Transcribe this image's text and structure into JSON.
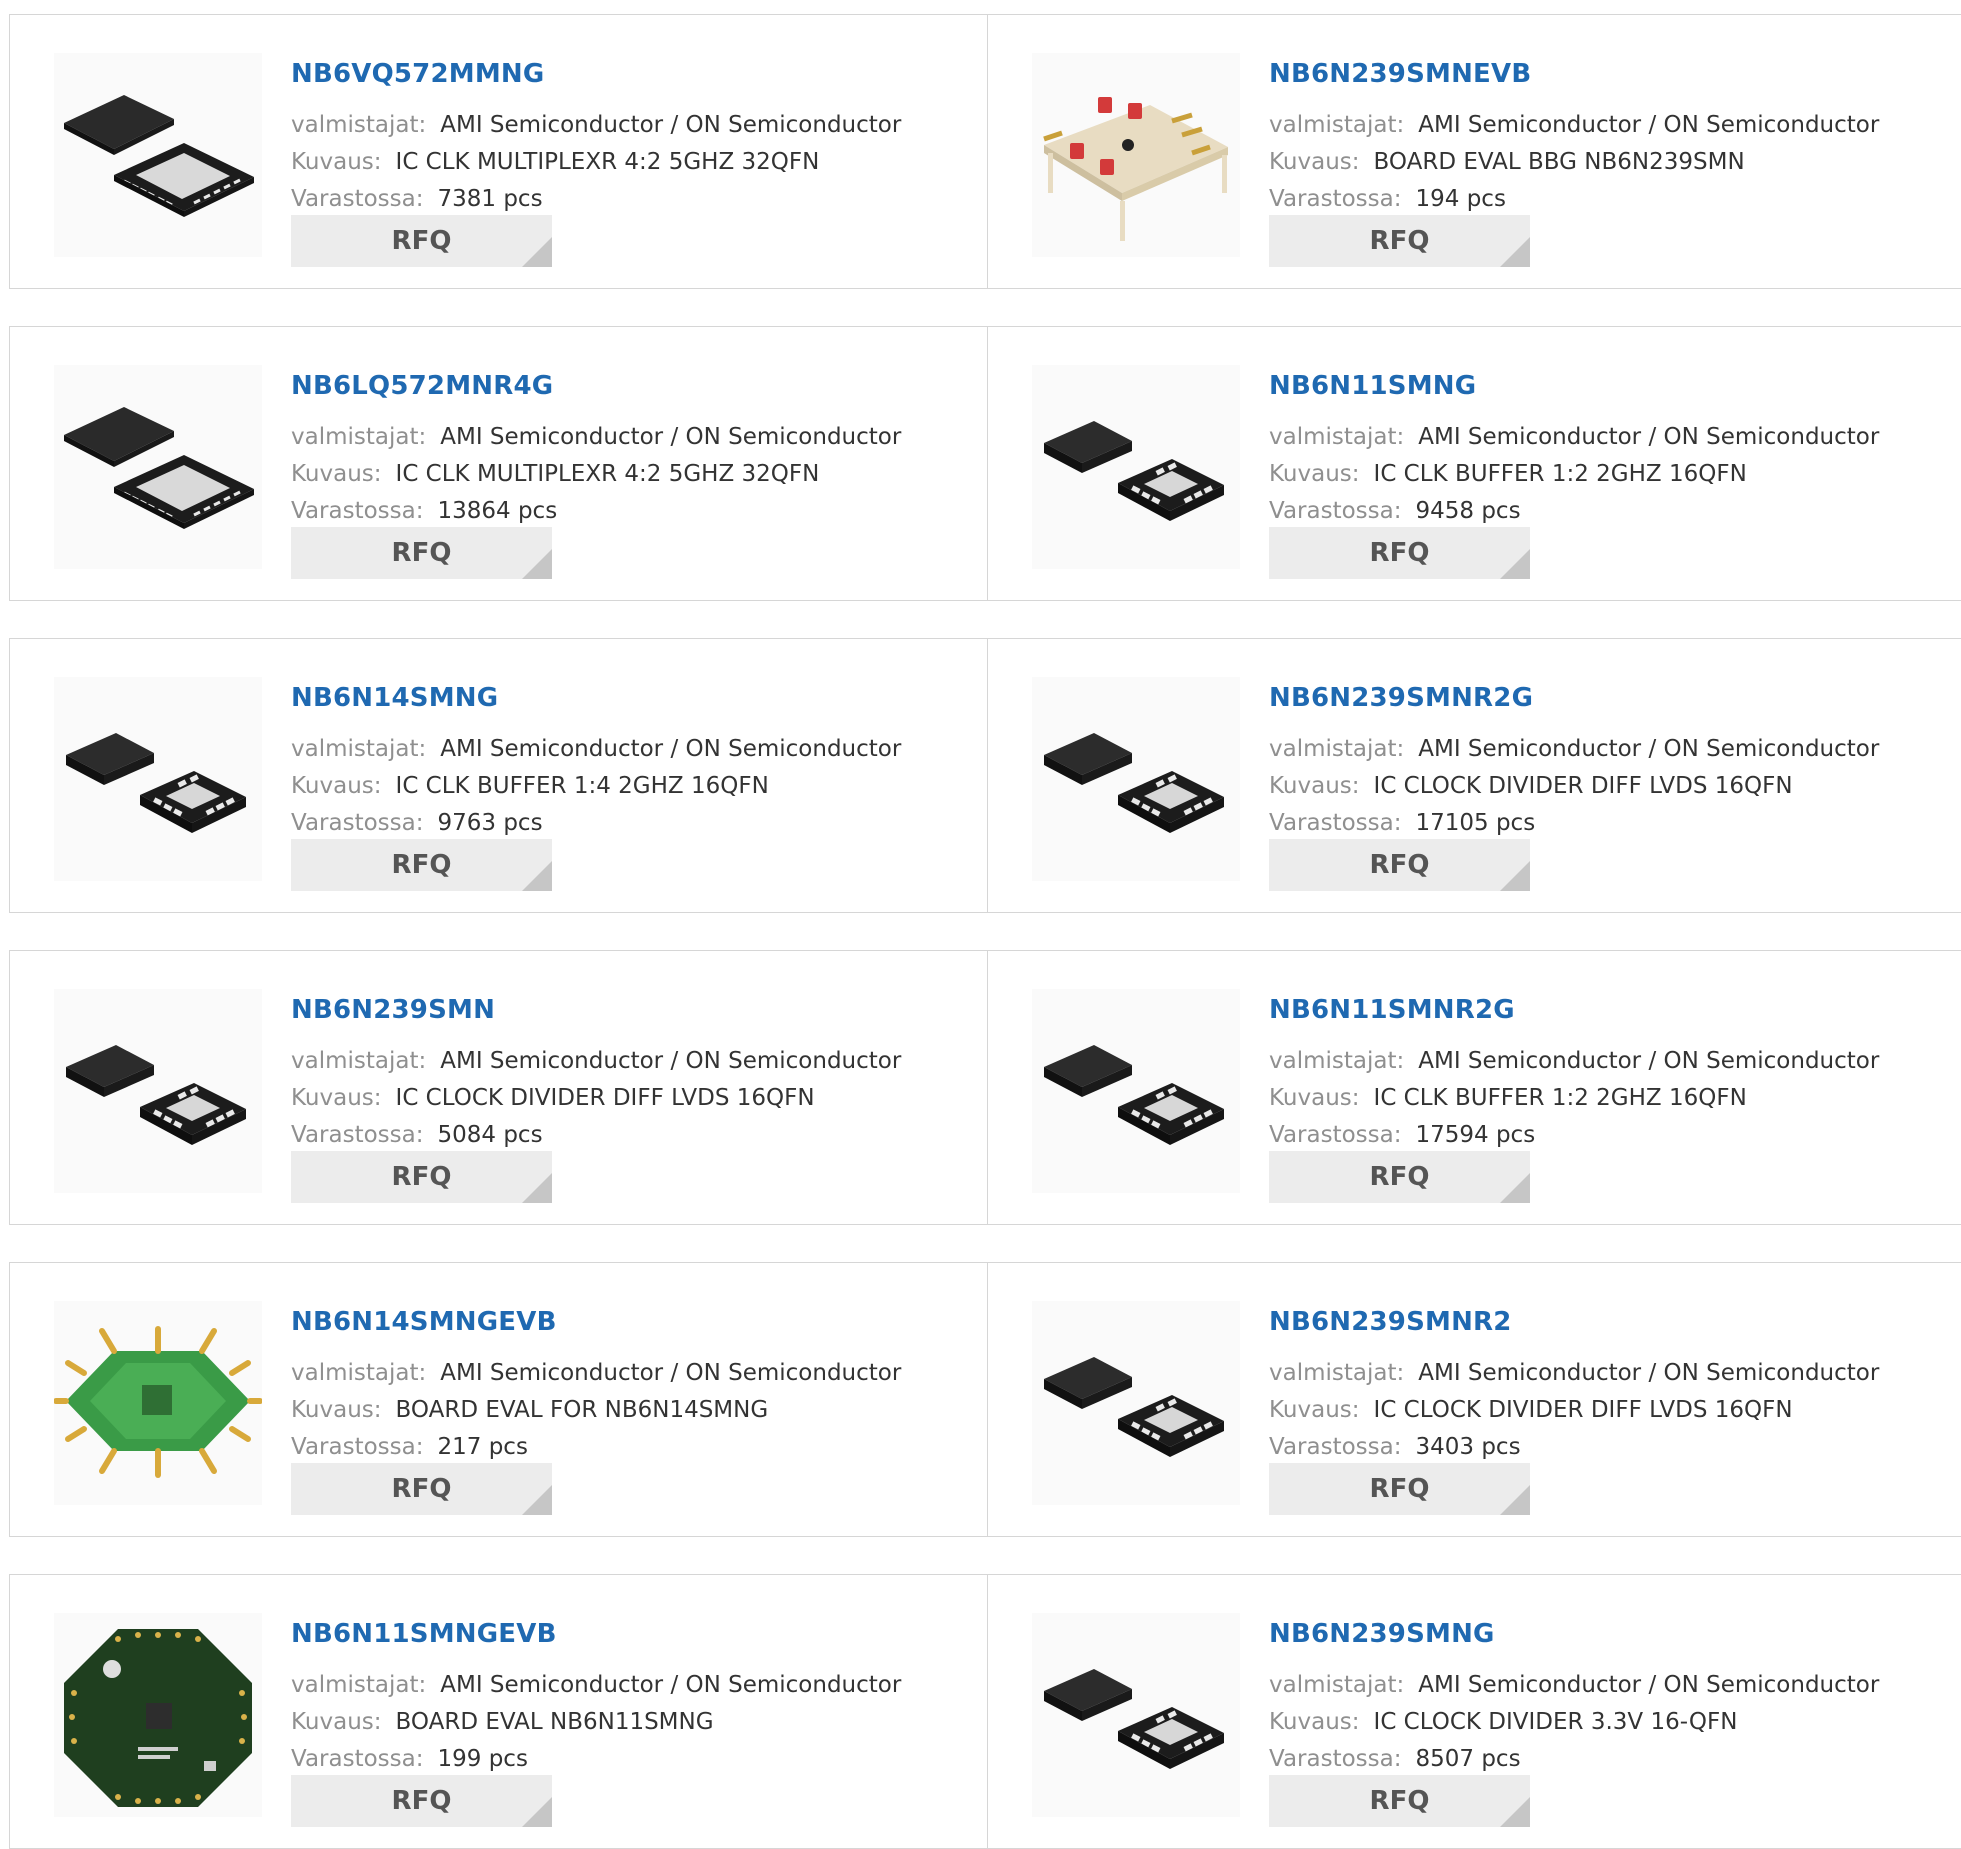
{
  "labels": {
    "manufacturer": "valmistajat:",
    "description": "Kuvaus:",
    "stock": "Varastossa:",
    "rfq": "RFQ"
  },
  "products": [
    {
      "part": "NB6VQ572MMNG",
      "manufacturer": "AMI Semiconductor / ON Semiconductor",
      "description": "IC CLK MULTIPLEXR 4:2 5GHZ 32QFN",
      "stock": "7381 pcs",
      "image": "qfn32-chip-icon"
    },
    {
      "part": "NB6N239SMNEVB",
      "manufacturer": "AMI Semiconductor / ON Semiconductor",
      "description": "BOARD EVAL BBG NB6N239SMN",
      "stock": "194 pcs",
      "image": "eval-board-square-icon"
    },
    {
      "part": "NB6LQ572MNR4G",
      "manufacturer": "AMI Semiconductor / ON Semiconductor",
      "description": "IC CLK MULTIPLEXR 4:2 5GHZ 32QFN",
      "stock": "13864 pcs",
      "image": "qfn32-chip-icon"
    },
    {
      "part": "NB6N11SMNG",
      "manufacturer": "AMI Semiconductor / ON Semiconductor",
      "description": "IC CLK BUFFER 1:2 2GHZ 16QFN",
      "stock": "9458 pcs",
      "image": "qfn16-chip-icon"
    },
    {
      "part": "NB6N14SMNG",
      "manufacturer": "AMI Semiconductor / ON Semiconductor",
      "description": "IC CLK BUFFER 1:4 2GHZ 16QFN",
      "stock": "9763 pcs",
      "image": "qfn16-chip-icon"
    },
    {
      "part": "NB6N239SMNR2G",
      "manufacturer": "AMI Semiconductor / ON Semiconductor",
      "description": "IC CLOCK DIVIDER DIFF LVDS 16QFN",
      "stock": "17105 pcs",
      "image": "qfn16-chip-icon"
    },
    {
      "part": "NB6N239SMN",
      "manufacturer": "AMI Semiconductor / ON Semiconductor",
      "description": "IC CLOCK DIVIDER DIFF LVDS 16QFN",
      "stock": "5084 pcs",
      "image": "qfn16-chip-icon"
    },
    {
      "part": "NB6N11SMNR2G",
      "manufacturer": "AMI Semiconductor / ON Semiconductor",
      "description": "IC CLK BUFFER 1:2 2GHZ 16QFN",
      "stock": "17594 pcs",
      "image": "qfn16-chip-icon"
    },
    {
      "part": "NB6N14SMNGEVB",
      "manufacturer": "AMI Semiconductor / ON Semiconductor",
      "description": "BOARD EVAL FOR NB6N14SMNG",
      "stock": "217 pcs",
      "image": "eval-board-octagon-icon"
    },
    {
      "part": "NB6N239SMNR2",
      "manufacturer": "AMI Semiconductor / ON Semiconductor",
      "description": "IC CLOCK DIVIDER DIFF LVDS 16QFN",
      "stock": "3403 pcs",
      "image": "qfn16-chip-icon"
    },
    {
      "part": "NB6N11SMNGEVB",
      "manufacturer": "AMI Semiconductor / ON Semiconductor",
      "description": "BOARD EVAL NB6N11SMNG",
      "stock": "199 pcs",
      "image": "eval-board-dark-octagon-icon"
    },
    {
      "part": "NB6N239SMNG",
      "manufacturer": "AMI Semiconductor / ON Semiconductor",
      "description": "IC CLOCK DIVIDER 3.3V 16-QFN",
      "stock": "8507 pcs",
      "image": "qfn16-chip-icon"
    }
  ],
  "colors": {
    "part_link": "#1f69b1",
    "label": "#8f8f8f",
    "value": "#333333",
    "rfq_bg": "#ececec",
    "border": "#d6d6d6"
  }
}
